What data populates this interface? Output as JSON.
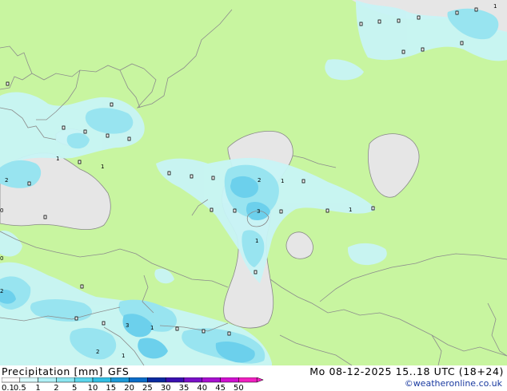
{
  "map": {
    "cell_values": [
      "1",
      "2",
      "0",
      "1",
      "2",
      "1",
      "3",
      "1",
      "0",
      "1",
      "2",
      "3",
      "1",
      "1",
      "2",
      "1"
    ]
  },
  "legend": {
    "title": "Precipitation [mm]",
    "model": "GFS",
    "scale_labels": [
      "0.1",
      "0.5",
      "1",
      "2",
      "5",
      "10",
      "15",
      "20",
      "25",
      "30",
      "35",
      "40",
      "45",
      "50"
    ],
    "scale_colors": [
      "#ffffff",
      "#d8fafc",
      "#b0f0f6",
      "#8ce6f0",
      "#5cd6ec",
      "#32bfe4",
      "#1e9ad8",
      "#0a6cc8",
      "#0a2aa0",
      "#3a10b0",
      "#7a10c8",
      "#a810d0",
      "#d010d0",
      "#f020c0"
    ]
  },
  "header": {
    "datetime": "Mo 08-12-2025 15..18 UTC (18+24)",
    "credit": "©weatheronline.co.uk"
  },
  "colors": {
    "land": "#c8f5a0",
    "sea": "#e6e6e6",
    "precip_light": "#c8f4f6",
    "precip_medium": "#98e4f0",
    "precip_heavy": "#6cd0ec",
    "border": "#888888"
  }
}
